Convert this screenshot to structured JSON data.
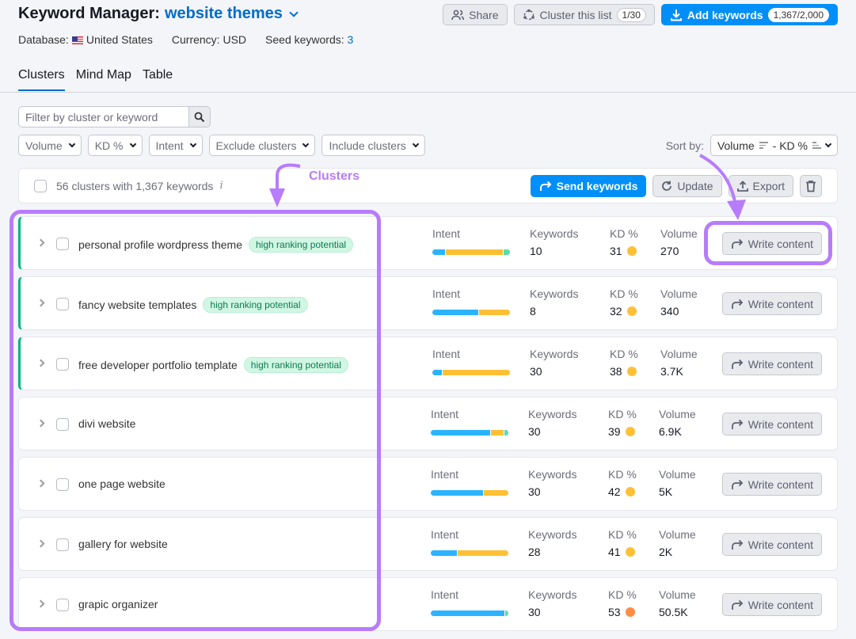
{
  "header": {
    "title_prefix": "Keyword Manager:",
    "project_name": "website themes",
    "database_label": "Database:",
    "database_value": "United States",
    "currency": "Currency: USD",
    "seed_label": "Seed keywords:",
    "seed_count": "3"
  },
  "top_actions": {
    "share": "Share",
    "cluster": "Cluster this list",
    "cluster_count": "1/30",
    "add_keywords": "Add keywords",
    "add_count": "1,367/2,000"
  },
  "tabs": [
    "Clusters",
    "Mind Map",
    "Table"
  ],
  "active_tab": "Clusters",
  "search": {
    "placeholder": "Filter by cluster or keyword"
  },
  "filters": [
    "Volume",
    "KD %",
    "Intent",
    "Exclude clusters",
    "Include clusters"
  ],
  "sort": {
    "label": "Sort by:",
    "primary": "Volume",
    "secondary": "- KD %"
  },
  "summary": {
    "text": "56 clusters with 1,367 keywords",
    "send": "Send keywords",
    "update": "Update",
    "export": "Export"
  },
  "annotation": {
    "label": "Clusters",
    "color": "#b77cfb"
  },
  "column_labels": {
    "intent": "Intent",
    "keywords": "Keywords",
    "kd": "KD %",
    "volume": "Volume",
    "action": "Write content"
  },
  "colors": {
    "accent": "#008ff8",
    "informational": "#2bb3ff",
    "commercial": "#ffc035",
    "transactional": "#59ddaa",
    "kd_medium": "#ffc035",
    "kd_hard": "#ff8c43",
    "hrp_border": "#00b67a"
  },
  "clusters": [
    {
      "name": "personal profile wordpress theme",
      "badge": "high ranking potential",
      "intent": [
        0.17,
        0.75,
        0.08
      ],
      "keywords": "10",
      "kd": "31",
      "kd_level": "medium",
      "volume": "270"
    },
    {
      "name": "fancy website templates",
      "badge": "high ranking potential",
      "intent": [
        0.6,
        0.4,
        0
      ],
      "keywords": "8",
      "kd": "32",
      "kd_level": "medium",
      "volume": "340"
    },
    {
      "name": "free developer portfolio template",
      "badge": "high ranking potential",
      "intent": [
        0.12,
        0.88,
        0
      ],
      "keywords": "30",
      "kd": "38",
      "kd_level": "medium",
      "volume": "3.7K"
    },
    {
      "name": "divi website",
      "badge": "",
      "intent": [
        0.78,
        0.17,
        0.05
      ],
      "keywords": "30",
      "kd": "39",
      "kd_level": "medium",
      "volume": "6.9K"
    },
    {
      "name": "one page website",
      "badge": "",
      "intent": [
        0.68,
        0.32,
        0
      ],
      "keywords": "30",
      "kd": "42",
      "kd_level": "medium",
      "volume": "5K"
    },
    {
      "name": "gallery for website",
      "badge": "",
      "intent": [
        0.34,
        0.66,
        0
      ],
      "keywords": "28",
      "kd": "41",
      "kd_level": "medium",
      "volume": "2K"
    },
    {
      "name": "grapic organizer",
      "badge": "",
      "intent": [
        0.96,
        0,
        0.04
      ],
      "keywords": "30",
      "kd": "53",
      "kd_level": "hard",
      "volume": "50.5K"
    }
  ]
}
